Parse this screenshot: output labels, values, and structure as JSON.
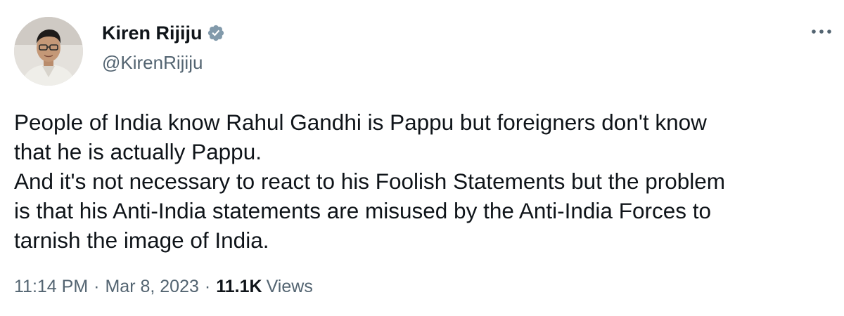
{
  "author": {
    "display_name": "Kiren Rijiju",
    "handle": "@KirenRijiju",
    "verified": true,
    "verified_color": "#829aab",
    "avatar_icon": "profile-photo"
  },
  "tweet": {
    "lines": [
      "People of India know Rahul Gandhi is Pappu but foreigners don't know",
      "that he is actually Pappu.",
      "And it's not necessary to react to his Foolish Statements but the problem",
      "is that his Anti-India statements are misused by the Anti-India Forces to",
      "tarnish the image of India."
    ]
  },
  "meta": {
    "time": "11:14 PM",
    "separator": "·",
    "date": "Mar 8, 2023",
    "views_count": "11.1K",
    "views_label": "Views"
  },
  "colors": {
    "text": "#0f1419",
    "secondary": "#536471",
    "background": "#ffffff"
  }
}
